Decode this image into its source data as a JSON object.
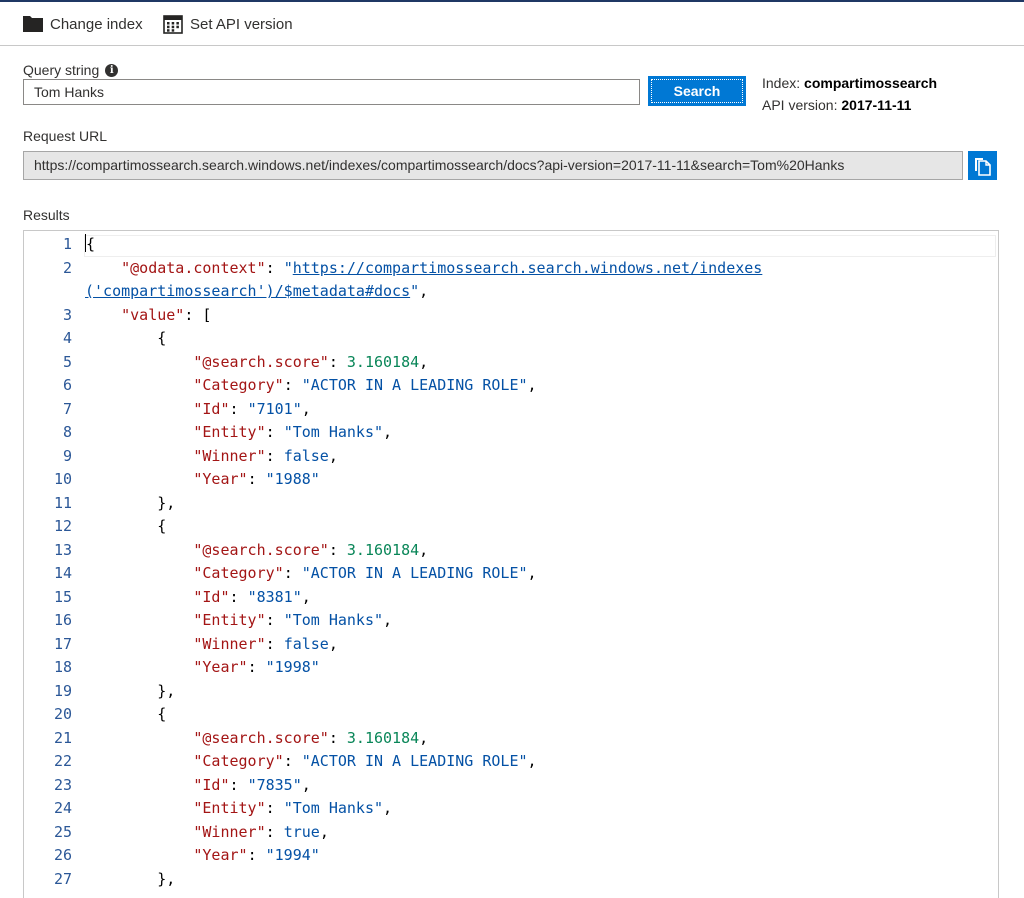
{
  "toolbar": {
    "change_index_label": "Change index",
    "set_api_version_label": "Set API version"
  },
  "query": {
    "label": "Query string",
    "value": "Tom Hanks",
    "search_button": "Search"
  },
  "info": {
    "index_label": "Index:",
    "index_value": "compartimossearch",
    "api_label": "API version:",
    "api_value": "2017-11-11"
  },
  "request": {
    "label": "Request URL",
    "url": "https://compartimossearch.search.windows.net/indexes/compartimossearch/docs?api-version=2017-11-11&search=Tom%20Hanks"
  },
  "results": {
    "label": "Results",
    "context_key": "\"@odata.context\"",
    "context_url_1": "https://compartimossearch.search.windows.net/indexes",
    "context_url_2": "('compartimossearch')/$metadata#docs",
    "value_key": "\"value\"",
    "docs": [
      {
        "score": "3.160184",
        "category": "\"ACTOR IN A LEADING ROLE\"",
        "id": "\"7101\"",
        "entity": "\"Tom Hanks\"",
        "winner": "false",
        "year": "\"1988\""
      },
      {
        "score": "3.160184",
        "category": "\"ACTOR IN A LEADING ROLE\"",
        "id": "\"8381\"",
        "entity": "\"Tom Hanks\"",
        "winner": "false",
        "year": "\"1998\""
      },
      {
        "score": "3.160184",
        "category": "\"ACTOR IN A LEADING ROLE\"",
        "id": "\"7835\"",
        "entity": "\"Tom Hanks\"",
        "winner": "true",
        "year": "\"1994\""
      }
    ],
    "field_keys": {
      "score": "\"@search.score\"",
      "category": "\"Category\"",
      "id": "\"Id\"",
      "entity": "\"Entity\"",
      "winner": "\"Winner\"",
      "year": "\"Year\""
    }
  },
  "colors": {
    "accent": "#0078d4",
    "json_key": "#a31515",
    "json_string": "#0451a5",
    "json_number": "#098658",
    "line_number": "#2b5797"
  }
}
